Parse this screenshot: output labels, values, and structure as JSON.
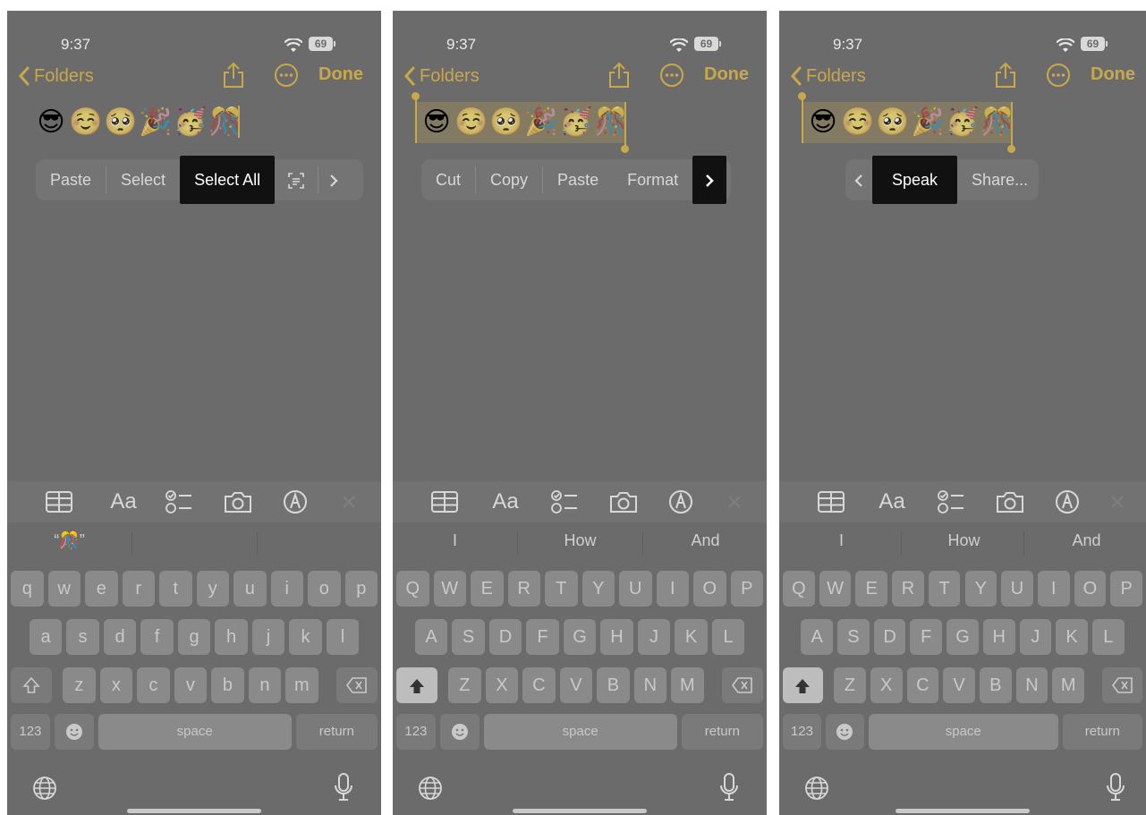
{
  "status": {
    "time": "9:37",
    "battery": "69"
  },
  "nav": {
    "back_label": "Folders",
    "done_label": "Done"
  },
  "note": {
    "emojis": [
      "😎",
      "☺️",
      "🥺",
      "🎉",
      "🥳",
      "🎊"
    ]
  },
  "menus": [
    {
      "items": [
        "Paste",
        "Select",
        "Select All"
      ],
      "active": "Select All"
    },
    {
      "items": [
        "Cut",
        "Copy",
        "Paste",
        "Format"
      ]
    },
    {
      "items": [
        "Speak",
        "Share..."
      ],
      "active": "Speak"
    }
  ],
  "suggestions": [
    {
      "items": [
        "“🎊”",
        "",
        ""
      ]
    },
    {
      "items": [
        "I",
        "How",
        "And"
      ]
    },
    {
      "items": [
        "I",
        "How",
        "And"
      ]
    }
  ],
  "keyboards": [
    {
      "row1": [
        "q",
        "w",
        "e",
        "r",
        "t",
        "y",
        "u",
        "i",
        "o",
        "p"
      ],
      "row2": [
        "a",
        "s",
        "d",
        "f",
        "g",
        "h",
        "j",
        "k",
        "l"
      ],
      "row3": [
        "z",
        "x",
        "c",
        "v",
        "b",
        "n",
        "m"
      ]
    },
    {
      "row1": [
        "Q",
        "W",
        "E",
        "R",
        "T",
        "Y",
        "U",
        "I",
        "O",
        "P"
      ],
      "row2": [
        "A",
        "S",
        "D",
        "F",
        "G",
        "H",
        "J",
        "K",
        "L"
      ],
      "row3": [
        "Z",
        "X",
        "C",
        "V",
        "B",
        "N",
        "M"
      ]
    },
    {
      "row1": [
        "Q",
        "W",
        "E",
        "R",
        "T",
        "Y",
        "U",
        "I",
        "O",
        "P"
      ],
      "row2": [
        "A",
        "S",
        "D",
        "F",
        "G",
        "H",
        "J",
        "K",
        "L"
      ],
      "row3": [
        "Z",
        "X",
        "C",
        "V",
        "B",
        "N",
        "M"
      ]
    }
  ],
  "keys": {
    "numbers": "123",
    "space": "space",
    "return": "return"
  },
  "toolbar": {
    "format_label": "Aa"
  },
  "colors": {
    "accent": "#c9a84a",
    "highlight": "#111111",
    "background": "#6b6b6b"
  }
}
